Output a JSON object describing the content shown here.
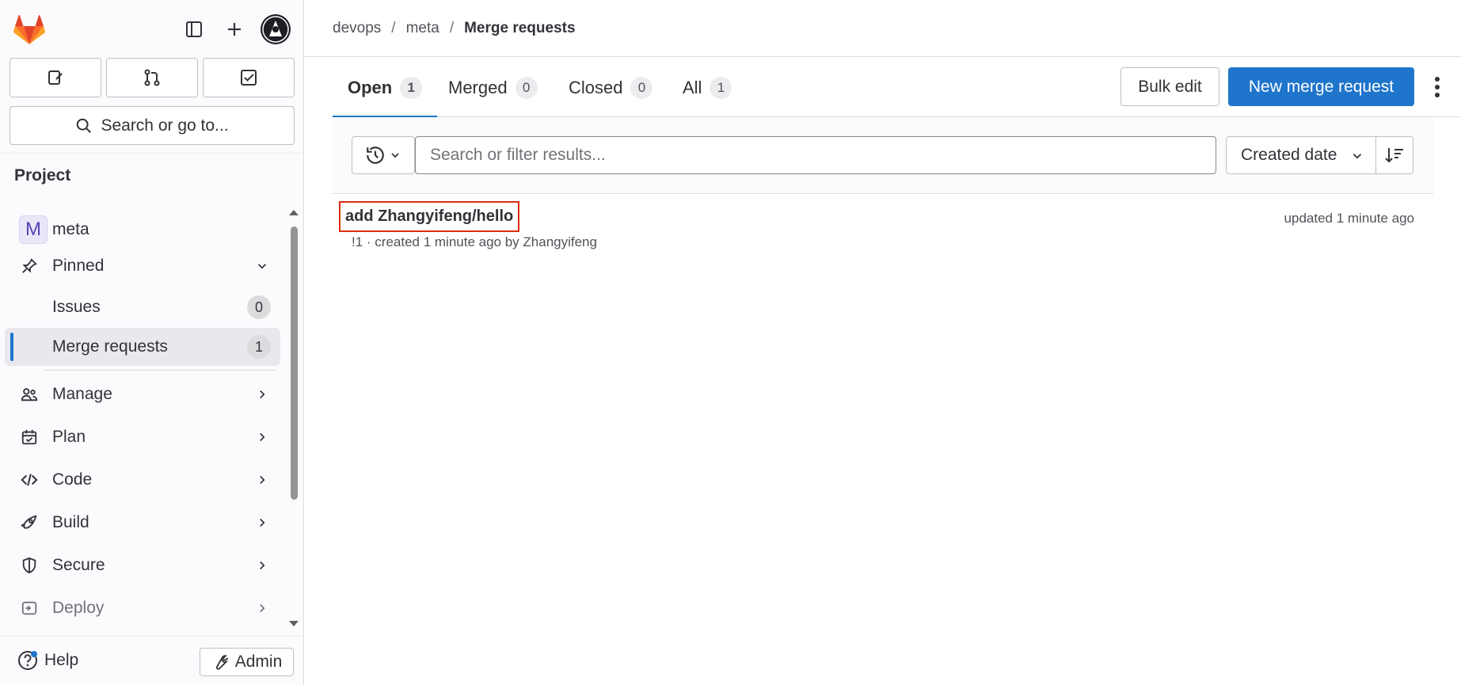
{
  "sidebar": {
    "search_label": "Search or go to...",
    "section_title": "Project",
    "project_name": "meta",
    "project_initial": "M",
    "pinned_label": "Pinned",
    "pinned_items": [
      {
        "label": "Issues",
        "count": "0"
      },
      {
        "label": "Merge requests",
        "count": "1"
      }
    ],
    "groups": [
      "Manage",
      "Plan",
      "Code",
      "Build",
      "Secure",
      "Deploy"
    ],
    "help_label": "Help",
    "admin_label": "Admin"
  },
  "breadcrumb": {
    "items": [
      "devops",
      "meta"
    ],
    "current": "Merge requests"
  },
  "tabs": [
    {
      "label": "Open",
      "count": "1"
    },
    {
      "label": "Merged",
      "count": "0"
    },
    {
      "label": "Closed",
      "count": "0"
    },
    {
      "label": "All",
      "count": "1"
    }
  ],
  "actions": {
    "bulk_edit": "Bulk edit",
    "new_mr": "New merge request"
  },
  "filter": {
    "placeholder": "Search or filter results...",
    "sort_label": "Created date"
  },
  "merge_requests": [
    {
      "title": "add Zhangyifeng/hello",
      "meta": "!1 · created 1 minute ago by Zhangyifeng",
      "updated": "updated 1 minute ago"
    }
  ],
  "colors": {
    "accent": "#1f75cb",
    "highlight_border": "#dd2b0e"
  }
}
